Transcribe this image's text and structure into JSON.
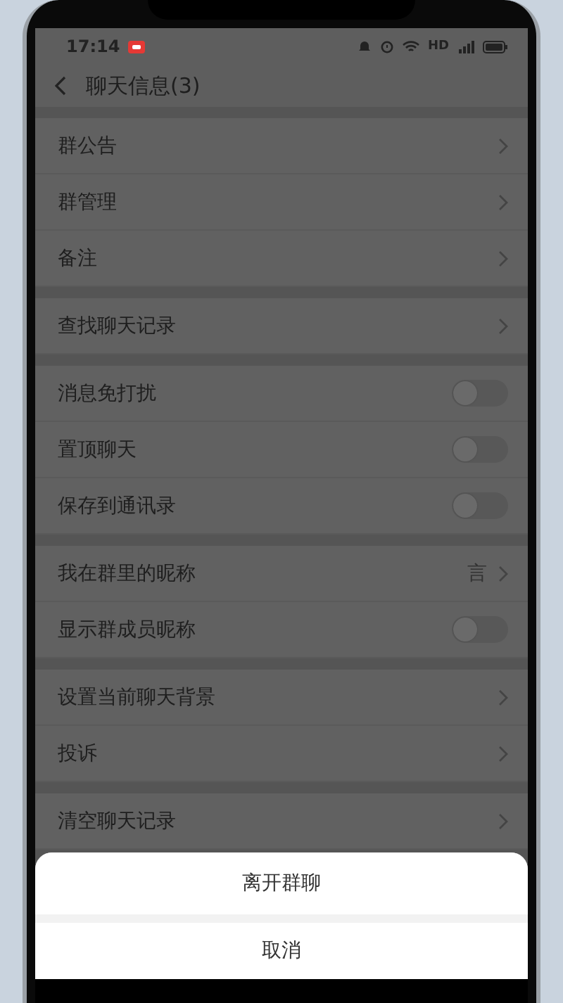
{
  "status_bar": {
    "time": "17:14",
    "network": "HD"
  },
  "header": {
    "title": "聊天信息(3)"
  },
  "sections": [
    {
      "rows": [
        {
          "kind": "link",
          "label": "群公告"
        },
        {
          "kind": "link",
          "label": "群管理"
        },
        {
          "kind": "link",
          "label": "备注"
        }
      ]
    },
    {
      "rows": [
        {
          "kind": "link",
          "label": "查找聊天记录"
        }
      ]
    },
    {
      "rows": [
        {
          "kind": "toggle",
          "label": "消息免打扰",
          "on": false
        },
        {
          "kind": "toggle",
          "label": "置顶聊天",
          "on": false
        },
        {
          "kind": "toggle",
          "label": "保存到通讯录",
          "on": false
        }
      ]
    },
    {
      "rows": [
        {
          "kind": "link",
          "label": "我在群里的昵称",
          "value": "言"
        },
        {
          "kind": "toggle",
          "label": "显示群成员昵称",
          "on": false
        }
      ]
    },
    {
      "rows": [
        {
          "kind": "link",
          "label": "设置当前聊天背景"
        },
        {
          "kind": "link",
          "label": "投诉"
        }
      ]
    },
    {
      "rows": [
        {
          "kind": "link",
          "label": "清空聊天记录"
        }
      ]
    }
  ],
  "action_sheet": {
    "actions": [
      "离开群聊"
    ],
    "cancel": "取消"
  }
}
